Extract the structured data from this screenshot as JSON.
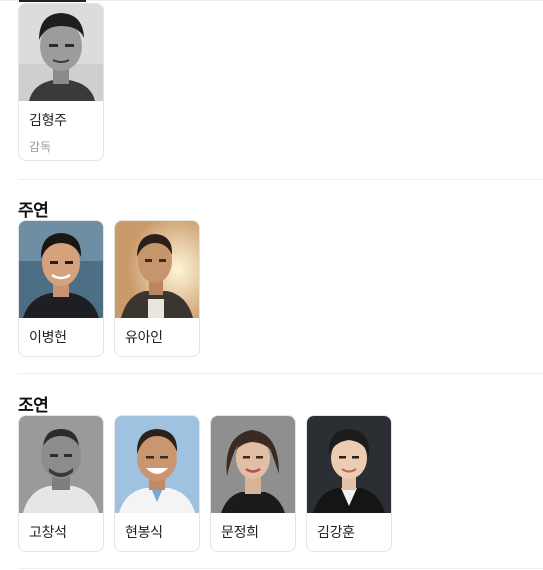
{
  "director": {
    "people": [
      {
        "name": "김형주",
        "role": "감독",
        "photo_icon": "director-portrait-icon"
      }
    ]
  },
  "lead": {
    "title": "주연",
    "people": [
      {
        "name": "이병헌",
        "photo_icon": "actor-portrait-icon"
      },
      {
        "name": "유아인",
        "photo_icon": "actor-portrait-icon"
      }
    ]
  },
  "supporting": {
    "title": "조연",
    "people": [
      {
        "name": "고창석",
        "photo_icon": "actor-portrait-icon"
      },
      {
        "name": "현봉식",
        "photo_icon": "actor-portrait-icon"
      },
      {
        "name": "문정희",
        "photo_icon": "actor-portrait-icon"
      },
      {
        "name": "김강훈",
        "photo_icon": "actor-portrait-icon"
      }
    ]
  },
  "colors": {
    "heading": "#111111",
    "name": "#222222",
    "role": "#9a9a9a",
    "card_border": "#e4e4e4",
    "divider": "#eeeeee"
  }
}
